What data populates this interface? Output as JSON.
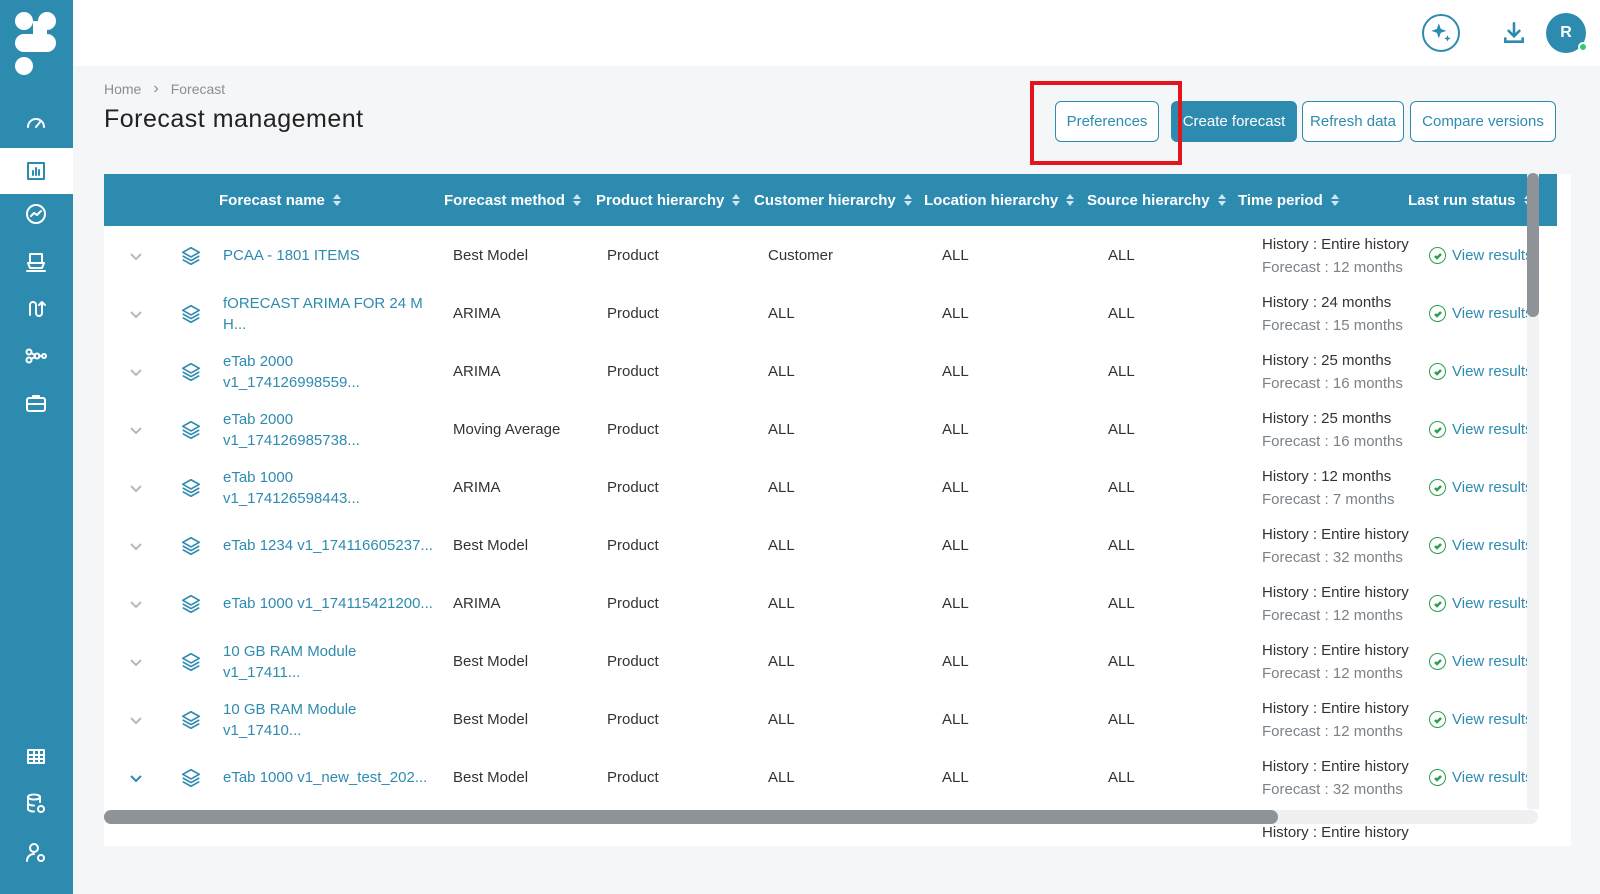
{
  "app": {
    "avatar_initial": "R",
    "accent_color": "#2e8bb0",
    "success_color": "#2e9e4e"
  },
  "sidebar": {
    "items": [
      {
        "icon": "speedometer-icon"
      },
      {
        "icon": "bar-chart-icon",
        "active": true
      },
      {
        "icon": "trend-circle-icon"
      },
      {
        "icon": "ship-icon"
      },
      {
        "icon": "route-icon"
      },
      {
        "icon": "network-icon"
      },
      {
        "icon": "briefcase-icon"
      }
    ],
    "bottom_items": [
      {
        "icon": "table-icon"
      },
      {
        "icon": "database-settings-icon"
      },
      {
        "icon": "user-settings-icon"
      }
    ]
  },
  "topbar": {
    "icons": [
      "ai-sparkle-icon",
      "download-icon"
    ]
  },
  "breadcrumb": {
    "home": "Home",
    "current": "Forecast"
  },
  "page": {
    "title": "Forecast management"
  },
  "toolbar": {
    "preferences": "Preferences",
    "create": "Create forecast",
    "refresh": "Refresh data",
    "compare": "Compare versions"
  },
  "table": {
    "columns": [
      "Forecast name",
      "Forecast method",
      "Product hierarchy",
      "Customer hierarchy",
      "Location hierarchy",
      "Source hierarchy",
      "Time period",
      "Last run status"
    ],
    "rows": [
      {
        "name": "PCAA - 1801 ITEMS",
        "method": "Best Model",
        "product": "Product",
        "customer": "Customer",
        "location": "ALL",
        "source": "ALL",
        "history": "History : Entire history",
        "forecast": "Forecast : 12 months",
        "status": "View results"
      },
      {
        "name": "fORECAST ARIMA FOR 24 M H...",
        "method": "ARIMA",
        "product": "Product",
        "customer": "ALL",
        "location": "ALL",
        "source": "ALL",
        "history": "History : 24 months",
        "forecast": "Forecast : 15 months",
        "status": "View results"
      },
      {
        "name": "eTab 2000 v1_174126998559...",
        "method": "ARIMA",
        "product": "Product",
        "customer": "ALL",
        "location": "ALL",
        "source": "ALL",
        "history": "History : 25 months",
        "forecast": "Forecast : 16 months",
        "status": "View results"
      },
      {
        "name": "eTab 2000 v1_174126985738...",
        "method": "Moving Average",
        "product": "Product",
        "customer": "ALL",
        "location": "ALL",
        "source": "ALL",
        "history": "History : 25 months",
        "forecast": "Forecast : 16 months",
        "status": "View results"
      },
      {
        "name": "eTab 1000 v1_174126598443...",
        "method": "ARIMA",
        "product": "Product",
        "customer": "ALL",
        "location": "ALL",
        "source": "ALL",
        "history": "History : 12 months",
        "forecast": "Forecast : 7 months",
        "status": "View results"
      },
      {
        "name": "eTab 1234 v1_174116605237...",
        "method": "Best Model",
        "product": "Product",
        "customer": "ALL",
        "location": "ALL",
        "source": "ALL",
        "history": "History : Entire history",
        "forecast": "Forecast : 32 months",
        "status": "View results"
      },
      {
        "name": "eTab 1000 v1_174115421200...",
        "method": "ARIMA",
        "product": "Product",
        "customer": "ALL",
        "location": "ALL",
        "source": "ALL",
        "history": "History : Entire history",
        "forecast": "Forecast : 12 months",
        "status": "View results"
      },
      {
        "name": "10 GB RAM Module v1_17411...",
        "method": "Best Model",
        "product": "Product",
        "customer": "ALL",
        "location": "ALL",
        "source": "ALL",
        "history": "History : Entire history",
        "forecast": "Forecast : 12 months",
        "status": "View results"
      },
      {
        "name": "10 GB RAM Module v1_17410...",
        "method": "Best Model",
        "product": "Product",
        "customer": "ALL",
        "location": "ALL",
        "source": "ALL",
        "history": "History : Entire history",
        "forecast": "Forecast : 12 months",
        "status": "View results"
      },
      {
        "name": "eTab 1000 v1_new_test_202...",
        "method": "Best Model",
        "product": "Product",
        "customer": "ALL",
        "location": "ALL",
        "source": "ALL",
        "history": "History : Entire history",
        "forecast": "Forecast : 32 months",
        "status": "View results",
        "expanded": true
      },
      {
        "name": "",
        "method": "",
        "product": "",
        "customer": "",
        "location": "",
        "source": "",
        "history": "History : Entire history",
        "forecast": "",
        "status": ""
      }
    ]
  }
}
